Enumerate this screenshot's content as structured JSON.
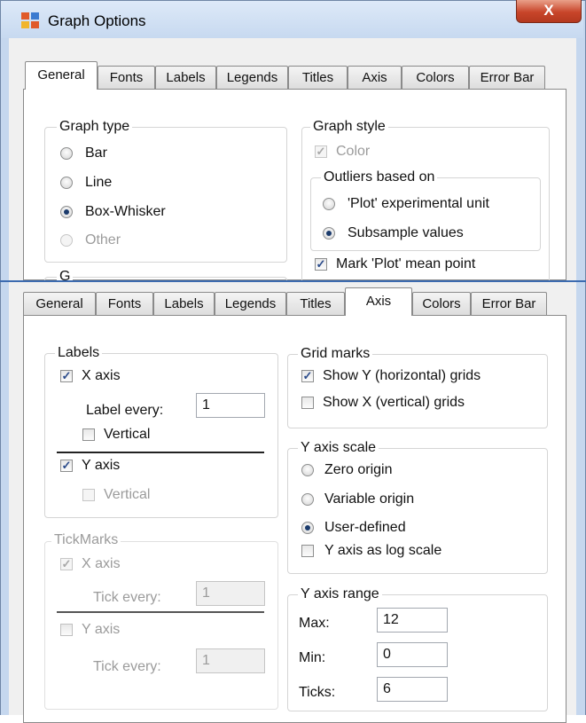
{
  "window": {
    "title": "Graph Options",
    "close_label": "X"
  },
  "tabs": [
    {
      "label": "General"
    },
    {
      "label": "Fonts"
    },
    {
      "label": "Labels"
    },
    {
      "label": "Legends"
    },
    {
      "label": "Titles"
    },
    {
      "label": "Axis"
    },
    {
      "label": "Colors"
    },
    {
      "label": "Error Bar"
    }
  ],
  "general": {
    "graph_type": {
      "title": "Graph type",
      "options": [
        "Bar",
        "Line",
        "Box-Whisker",
        "Other"
      ],
      "selected": "Box-Whisker"
    },
    "group_partial_title": "G",
    "graph_style": {
      "title": "Graph style",
      "color_label": "Color",
      "outliers": {
        "title": "Outliers based on",
        "options": [
          "'Plot' experimental unit",
          "Subsample values"
        ],
        "selected": "Subsample values"
      },
      "mark_mean_label": "Mark 'Plot' mean point"
    }
  },
  "axis": {
    "labels": {
      "title": "Labels",
      "x_axis": "X axis",
      "label_every": "Label every:",
      "label_every_value": "1",
      "x_vertical": "Vertical",
      "y_axis": "Y axis",
      "y_vertical": "Vertical"
    },
    "tickmarks": {
      "title": "TickMarks",
      "x_axis": "X axis",
      "x_tick_every": "Tick every:",
      "x_tick_value": "1",
      "y_axis": "Y axis",
      "y_tick_every": "Tick every:",
      "y_tick_value": "1"
    },
    "grid_marks": {
      "title": "Grid marks",
      "show_y": "Show Y (horizontal) grids",
      "show_x": "Show X (vertical) grids"
    },
    "y_scale": {
      "title": "Y axis scale",
      "options": [
        "Zero origin",
        "Variable origin",
        "User-defined"
      ],
      "selected": "User-defined",
      "log_scale": "Y axis as log scale"
    },
    "y_range": {
      "title": "Y axis range",
      "max_label": "Max:",
      "max_value": "12",
      "min_label": "Min:",
      "min_value": "0",
      "ticks_label": "Ticks:",
      "ticks_value": "6"
    }
  }
}
